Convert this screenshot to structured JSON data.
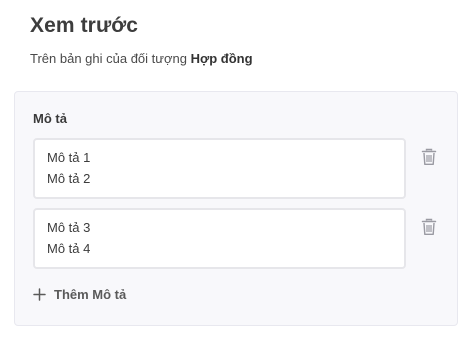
{
  "header": {
    "title": "Xem trước",
    "subtitle_prefix": "Trên bản ghi của đối tượng",
    "object_name": "Hợp đồng"
  },
  "field": {
    "label": "Mô tả",
    "entries": [
      {
        "lines": [
          "Mô tả 1",
          "Mô tả 2"
        ]
      },
      {
        "lines": [
          "Mô tả 3",
          "Mô tả 4"
        ]
      }
    ],
    "add_label": "Thêm Mô tả"
  },
  "icons": {
    "delete": "trash-icon",
    "add": "plus-icon"
  },
  "colors": {
    "panel_background": "#f8f8fb",
    "entry_border": "#e6e6ea",
    "icon": "#9a9aa2"
  }
}
